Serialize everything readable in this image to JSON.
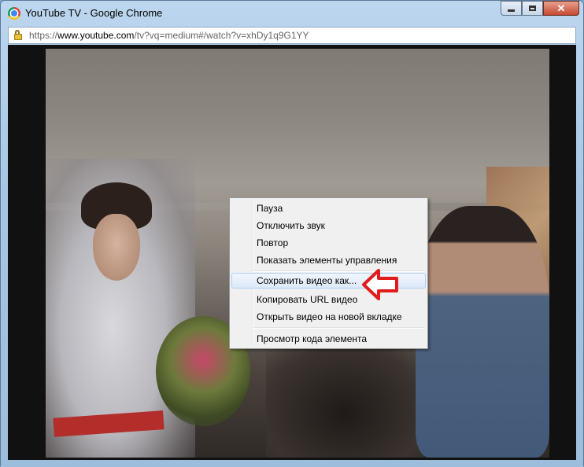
{
  "window": {
    "title": "YouTube TV - Google Chrome",
    "buttons": {
      "minimize": "minimize-icon",
      "maximize": "maximize-icon",
      "close": "✕"
    }
  },
  "address": {
    "scheme": "https://",
    "host": "www.youtube.com",
    "path": "/tv?vq=medium#/watch?v=xhDy1q9G1YY",
    "icon": "lock-warning-icon"
  },
  "context_menu": {
    "items": [
      {
        "label": "Пауза"
      },
      {
        "label": "Отключить звук"
      },
      {
        "label": "Повтор"
      },
      {
        "label": "Показать элементы управления"
      },
      {
        "label": "Сохранить видео как..."
      },
      {
        "label": "Копировать URL видео"
      },
      {
        "label": "Открыть видео на новой вкладке"
      },
      {
        "label": "Просмотр кода элемента"
      }
    ],
    "highlighted_index": 4
  },
  "annotation": {
    "icon": "red-arrow-left-icon",
    "color": "#e01c1c"
  },
  "colors": {
    "menu_bg": "#f0f0f0",
    "highlight_border": "#aecff7",
    "frame": "#9dbddc"
  }
}
